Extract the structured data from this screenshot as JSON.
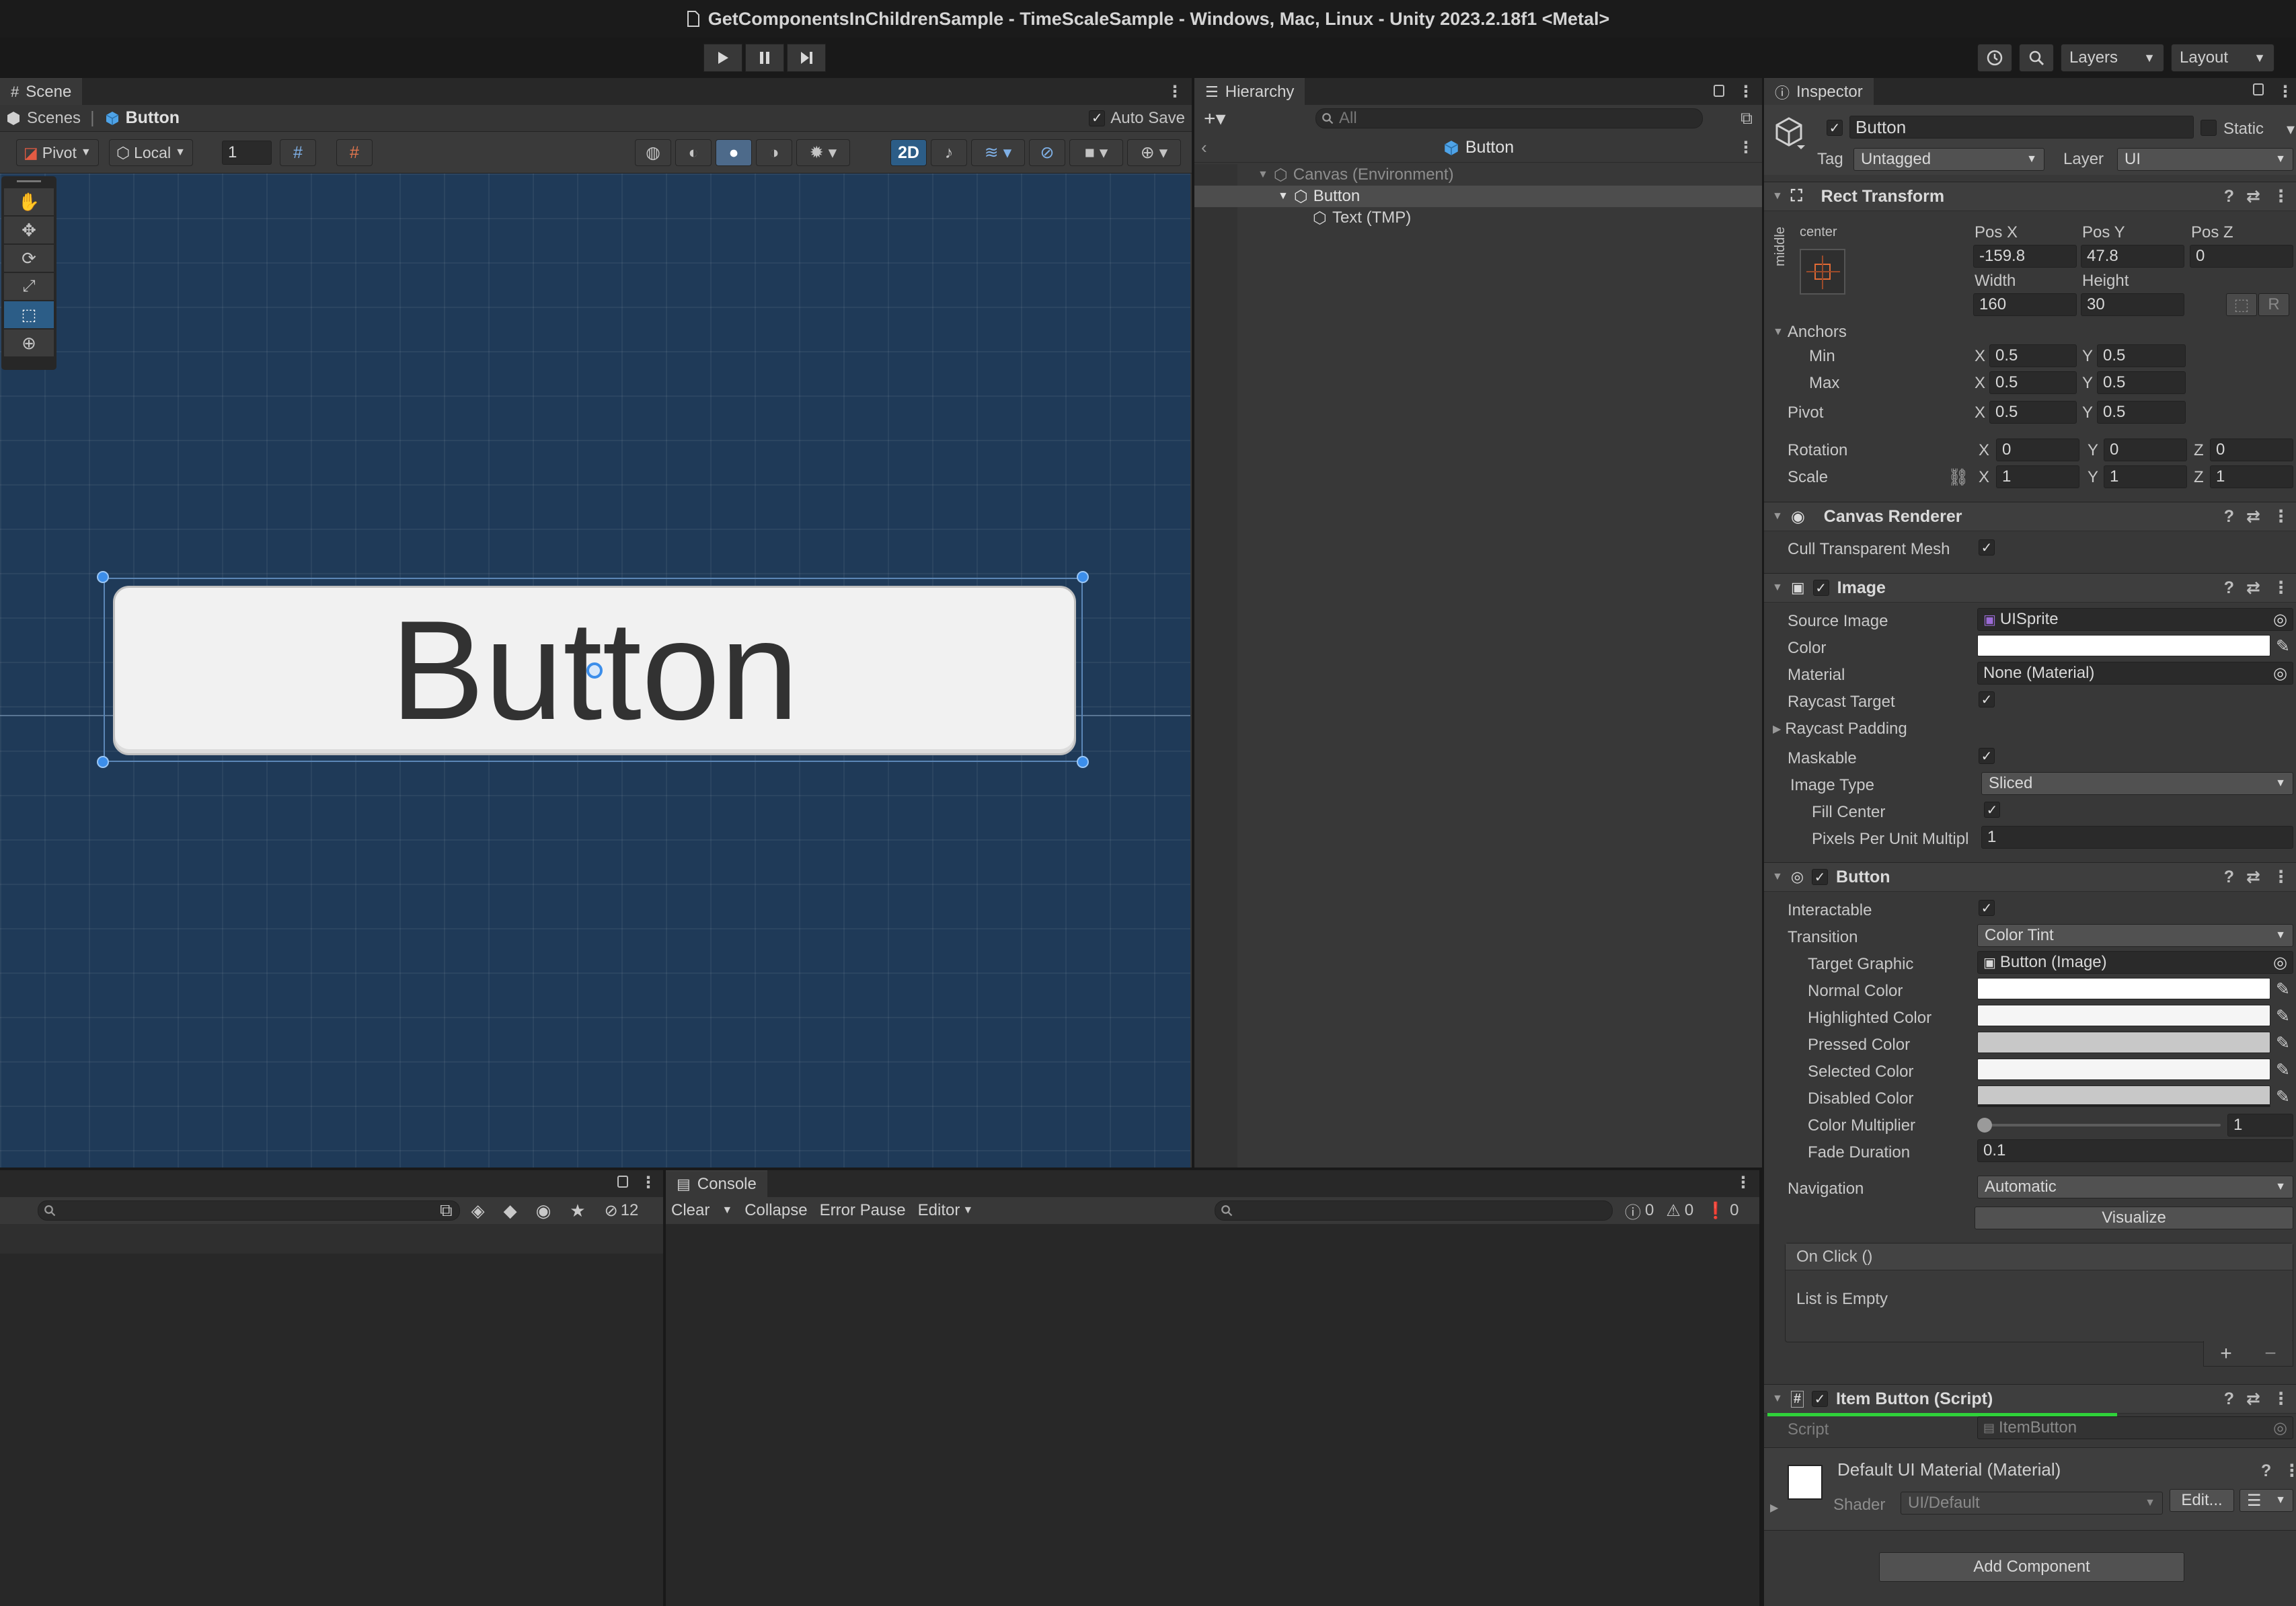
{
  "window": {
    "title": "GetComponentsInChildrenSample - TimeScaleSample - Windows, Mac, Linux - Unity 2023.2.18f1 <Metal>"
  },
  "toolbar": {
    "layers_label": "Layers",
    "layout_label": "Layout"
  },
  "scene": {
    "tab_label": "Scene",
    "breadcrumb_root": "Scenes",
    "breadcrumb_item": "Button",
    "auto_save_label": "Auto Save",
    "pivot_label": "Pivot",
    "local_label": "Local",
    "grid_value": "1",
    "mode_2d_label": "2D",
    "button_text": "Button"
  },
  "hierarchy": {
    "tab_label": "Hierarchy",
    "search_placeholder": "All",
    "header_title": "Button",
    "items": [
      {
        "label": "Canvas (Environment)"
      },
      {
        "label": "Button"
      },
      {
        "label": "Text (TMP)"
      }
    ]
  },
  "inspector": {
    "tab_label": "Inspector",
    "object_name": "Button",
    "static_label": "Static",
    "tag_label": "Tag",
    "tag_value": "Untagged",
    "layer_label": "Layer",
    "layer_value": "UI",
    "rect_transform": {
      "title": "Rect Transform",
      "anchor_preset_top": "center",
      "anchor_preset_side": "middle",
      "pos_x_label": "Pos X",
      "pos_x": "-159.8",
      "pos_y_label": "Pos Y",
      "pos_y": "47.8",
      "pos_z_label": "Pos Z",
      "pos_z": "0",
      "width_label": "Width",
      "width": "160",
      "height_label": "Height",
      "height": "30",
      "r_button": "R",
      "anchors_label": "Anchors",
      "min_label": "Min",
      "min_x": "0.5",
      "min_y": "0.5",
      "max_label": "Max",
      "max_x": "0.5",
      "max_y": "0.5",
      "pivot_label": "Pivot",
      "pivot_x": "0.5",
      "pivot_y": "0.5",
      "rotation_label": "Rotation",
      "rot_x": "0",
      "rot_y": "0",
      "rot_z": "0",
      "scale_label": "Scale",
      "scale_x": "1",
      "scale_y": "1",
      "scale_z": "1",
      "x": "X",
      "y": "Y",
      "z": "Z"
    },
    "canvas_renderer": {
      "title": "Canvas Renderer",
      "cull_label": "Cull Transparent Mesh"
    },
    "image": {
      "title": "Image",
      "source_image_label": "Source Image",
      "source_image": "UISprite",
      "color_label": "Color",
      "material_label": "Material",
      "material": "None (Material)",
      "raycast_target_label": "Raycast Target",
      "raycast_padding_label": "Raycast Padding",
      "maskable_label": "Maskable",
      "image_type_label": "Image Type",
      "image_type": "Sliced",
      "fill_center_label": "Fill Center",
      "ppu_label": "Pixels Per Unit Multipl",
      "ppu": "1"
    },
    "button": {
      "title": "Button",
      "interactable_label": "Interactable",
      "transition_label": "Transition",
      "transition": "Color Tint",
      "target_graphic_label": "Target Graphic",
      "target_graphic": "Button (Image)",
      "normal_label": "Normal Color",
      "highlighted_label": "Highlighted Color",
      "pressed_label": "Pressed Color",
      "selected_label": "Selected Color",
      "disabled_label": "Disabled Color",
      "multiplier_label": "Color Multiplier",
      "multiplier": "1",
      "fade_label": "Fade Duration",
      "fade": "0.1",
      "navigation_label": "Navigation",
      "navigation": "Automatic",
      "visualize_label": "Visualize",
      "onclick_label": "On Click ()",
      "list_empty": "List is Empty",
      "plus": "+",
      "minus": "−"
    },
    "item_button": {
      "title": "Item Button (Script)",
      "script_label": "Script",
      "script": "ItemButton"
    },
    "material_section": {
      "title": "Default UI Material (Material)",
      "shader_label": "Shader",
      "shader": "UI/Default",
      "edit_label": "Edit..."
    },
    "add_component_label": "Add Component"
  },
  "project": {
    "hidden_count": "12"
  },
  "console": {
    "tab_label": "Console",
    "clear_label": "Clear",
    "collapse_label": "Collapse",
    "error_pause_label": "Error Pause",
    "editor_label": "Editor",
    "log_count": "0",
    "warn_count": "0",
    "error_count": "0"
  },
  "colors": {
    "scene_bg": "#1f3a58",
    "panel_bg": "#383838",
    "selection": "#2c5d87",
    "accent_green": "#2fd23a",
    "handle_blue": "#3c8eea"
  }
}
